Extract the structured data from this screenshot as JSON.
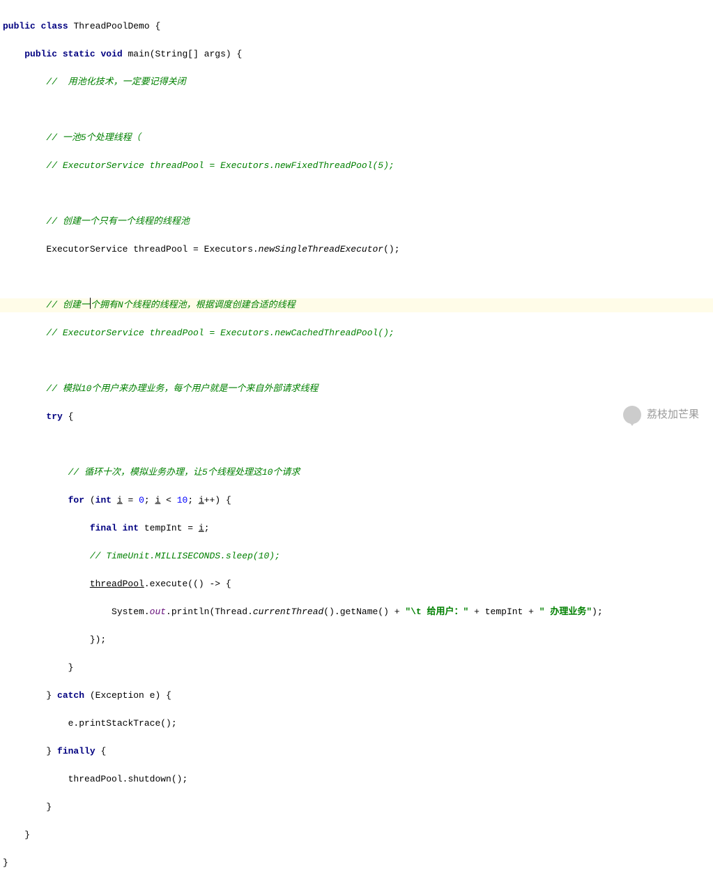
{
  "code": {
    "l1_kw1": "public",
    "l1_kw2": "class",
    "l1_class": " ThreadPoolDemo {",
    "l2_kw1": "public",
    "l2_kw2": "static",
    "l2_kw3": "void",
    "l2_sig": " main(String[] args) {",
    "l3": "//  用池化技术，一定要记得关闭",
    "l5": "// 一池5个处理线程（",
    "l6": "// ExecutorService threadPool = Executors.newFixedThreadPool(5);",
    "l8": "// 创建一个只有一个线程的线程池",
    "l9a": "ExecutorService threadPool = Executors.",
    "l9b": "newSingleThreadExecutor",
    "l9c": "();",
    "l11a": "// 创建一",
    "l11b": "个拥有N个线程的线程池，根据调度创建合适的线程",
    "l12": "// ExecutorService threadPool = Executors.newCachedThreadPool();",
    "l14": "// 模拟10个用户来办理业务，每个用户就是一个来自外部请求线程",
    "l15_kw": "try",
    "l15_rest": " {",
    "l17": "// 循环十次，模拟业务办理，让5个线程处理这10个请求",
    "l18_for": "for",
    "l18_p1": " (",
    "l18_int": "int",
    "l18_sp1": " ",
    "l18_i1": "i",
    "l18_eq": " = ",
    "l18_zero": "0",
    "l18_semi1": "; ",
    "l18_i2": "i",
    "l18_lt": " < ",
    "l18_ten": "10",
    "l18_semi2": "; ",
    "l18_i3": "i",
    "l18_pp": "++) {",
    "l19_final": "final",
    "l19_sp1": " ",
    "l19_int": "int",
    "l19_rest": " tempInt = ",
    "l19_i": "i",
    "l19_semi": ";",
    "l20": "// TimeUnit.MILLISECONDS.sleep(10);",
    "l21a": "threadPool",
    "l21b": ".execute(() -> {",
    "l22a": "System.",
    "l22out": "out",
    "l22b": ".println(Thread.",
    "l22c": "currentThread",
    "l22d": "().getName() + ",
    "l22s1": "\"\\t 给用户：\"",
    "l22e": " + tempInt + ",
    "l22s2": "\" 办理业务\"",
    "l22f": ");",
    "l23": "});",
    "l24": "}",
    "l25a": "} ",
    "l25_catch": "catch",
    "l25b": " (Exception e) {",
    "l26": "e.printStackTrace();",
    "l27a": "} ",
    "l27_finally": "finally",
    "l27b": " {",
    "l28": "threadPool.shutdown();",
    "l29": "}",
    "l30": "}",
    "l31": "}"
  },
  "indent": {
    "i0": "",
    "i1": "    ",
    "i2": "        ",
    "i3": "            ",
    "i4": "                ",
    "i5": "                    "
  },
  "watermark": "荔枝加芒果"
}
